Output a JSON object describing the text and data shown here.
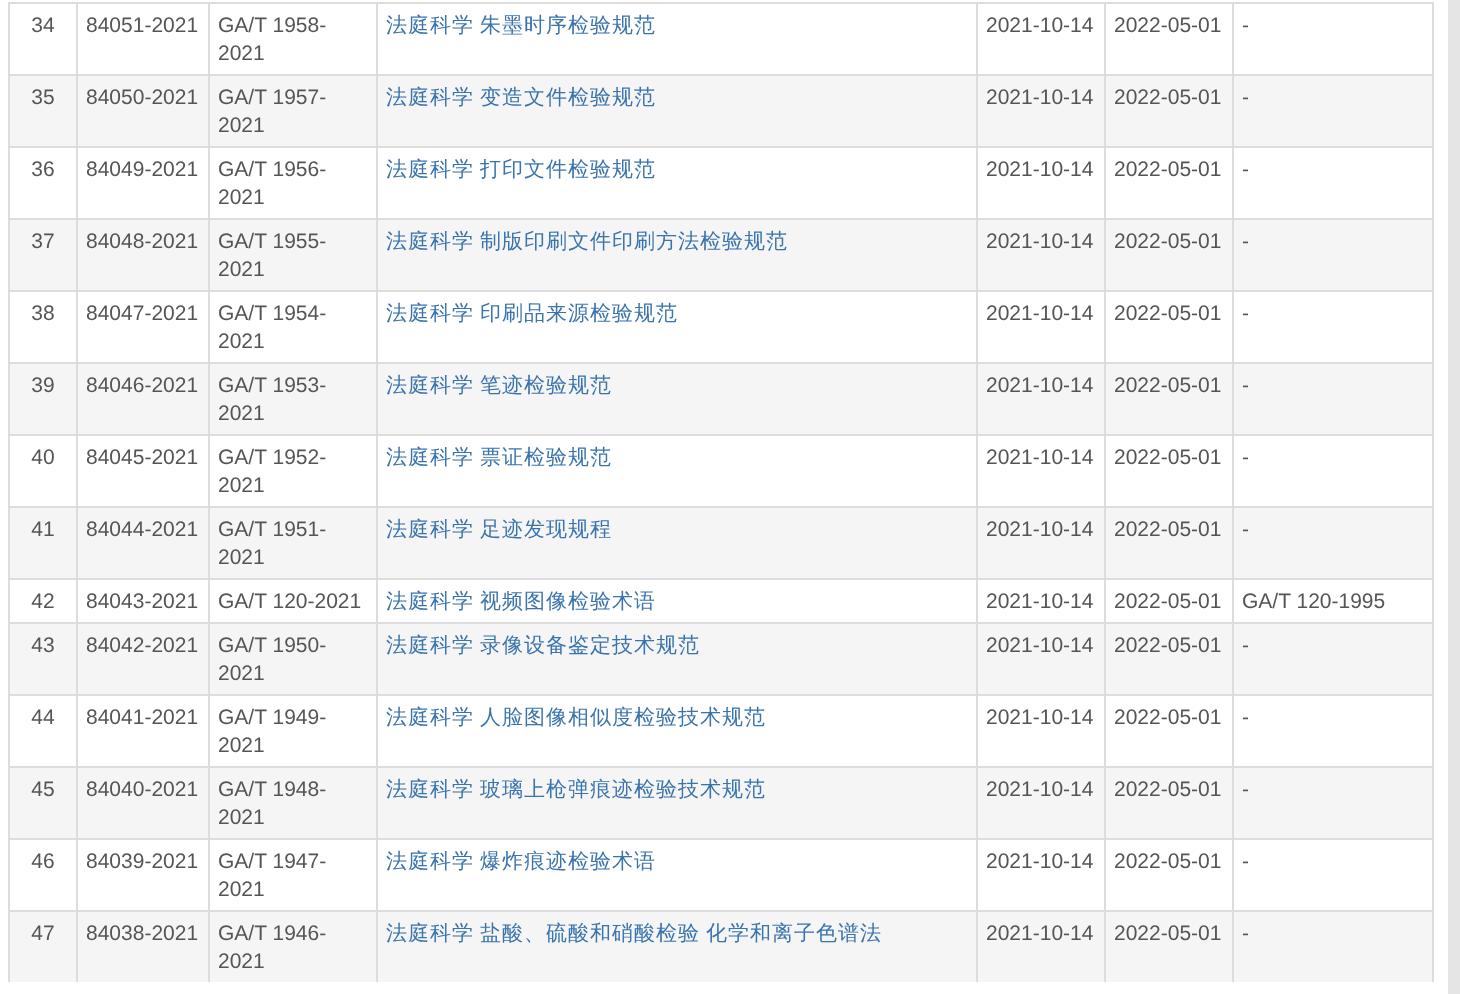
{
  "table": {
    "rows": [
      {
        "no": "34",
        "id": "84051-2021",
        "code": "GA/T 1958-2021",
        "title": "法庭科学 朱墨时序检验规范",
        "issued": "2021-10-14",
        "effective": "2022-05-01",
        "replaces": "-"
      },
      {
        "no": "35",
        "id": "84050-2021",
        "code": "GA/T 1957-2021",
        "title": "法庭科学 变造文件检验规范",
        "issued": "2021-10-14",
        "effective": "2022-05-01",
        "replaces": "-"
      },
      {
        "no": "36",
        "id": "84049-2021",
        "code": "GA/T 1956-2021",
        "title": "法庭科学 打印文件检验规范",
        "issued": "2021-10-14",
        "effective": "2022-05-01",
        "replaces": "-"
      },
      {
        "no": "37",
        "id": "84048-2021",
        "code": "GA/T 1955-2021",
        "title": "法庭科学 制版印刷文件印刷方法检验规范",
        "issued": "2021-10-14",
        "effective": "2022-05-01",
        "replaces": "-"
      },
      {
        "no": "38",
        "id": "84047-2021",
        "code": "GA/T 1954-2021",
        "title": "法庭科学 印刷品来源检验规范",
        "issued": "2021-10-14",
        "effective": "2022-05-01",
        "replaces": "-"
      },
      {
        "no": "39",
        "id": "84046-2021",
        "code": "GA/T 1953-2021",
        "title": "法庭科学 笔迹检验规范",
        "issued": "2021-10-14",
        "effective": "2022-05-01",
        "replaces": "-"
      },
      {
        "no": "40",
        "id": "84045-2021",
        "code": "GA/T 1952-2021",
        "title": "法庭科学 票证检验规范",
        "issued": "2021-10-14",
        "effective": "2022-05-01",
        "replaces": "-"
      },
      {
        "no": "41",
        "id": "84044-2021",
        "code": "GA/T 1951-2021",
        "title": "法庭科学 足迹发现规程",
        "issued": "2021-10-14",
        "effective": "2022-05-01",
        "replaces": "-"
      },
      {
        "no": "42",
        "id": "84043-2021",
        "code": "GA/T 120-2021",
        "title": "法庭科学 视频图像检验术语",
        "issued": "2021-10-14",
        "effective": "2022-05-01",
        "replaces": "GA/T 120-1995"
      },
      {
        "no": "43",
        "id": "84042-2021",
        "code": "GA/T 1950-2021",
        "title": "法庭科学 录像设备鉴定技术规范",
        "issued": "2021-10-14",
        "effective": "2022-05-01",
        "replaces": "-"
      },
      {
        "no": "44",
        "id": "84041-2021",
        "code": "GA/T 1949-2021",
        "title": "法庭科学 人脸图像相似度检验技术规范",
        "issued": "2021-10-14",
        "effective": "2022-05-01",
        "replaces": "-"
      },
      {
        "no": "45",
        "id": "84040-2021",
        "code": "GA/T 1948-2021",
        "title": "法庭科学 玻璃上枪弹痕迹检验技术规范",
        "issued": "2021-10-14",
        "effective": "2022-05-01",
        "replaces": "-"
      },
      {
        "no": "46",
        "id": "84039-2021",
        "code": "GA/T 1947-2021",
        "title": "法庭科学 爆炸痕迹检验术语",
        "issued": "2021-10-14",
        "effective": "2022-05-01",
        "replaces": "-"
      },
      {
        "no": "47",
        "id": "84038-2021",
        "code": "GA/T 1946-2021",
        "title": "法庭科学 盐酸、硫酸和硝酸检验 化学和离子色谱法",
        "issued": "2021-10-14",
        "effective": "2022-05-01",
        "replaces": "-"
      }
    ]
  }
}
